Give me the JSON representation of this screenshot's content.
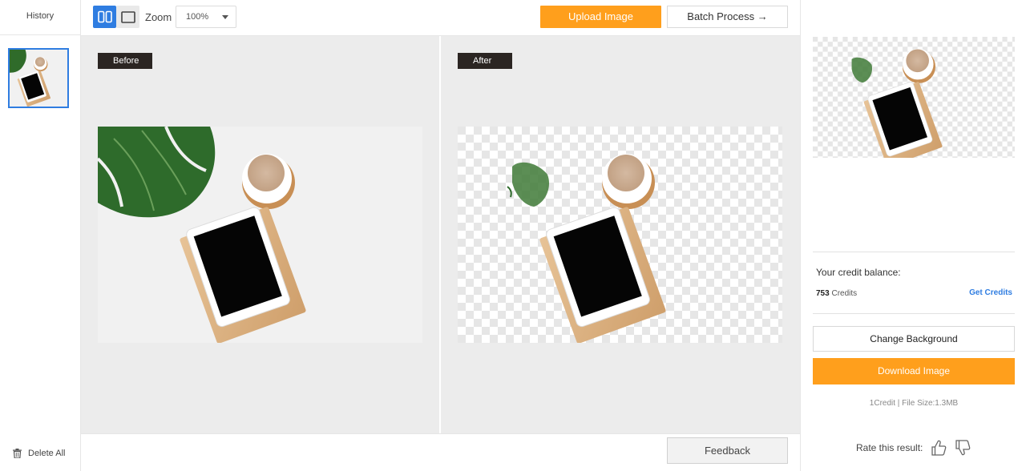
{
  "sidebar": {
    "title": "History",
    "delete_all": "Delete All"
  },
  "toolbar": {
    "zoom_label": "Zoom",
    "zoom_value": "100%",
    "upload_label": "Upload Image",
    "batch_label": "Batch Process →"
  },
  "compare": {
    "before_label": "Before",
    "after_label": "After"
  },
  "bottom": {
    "feedback_label": "Feedback"
  },
  "panel": {
    "credit_title": "Your credit balance:",
    "credit_number": "753",
    "credit_unit": " Credits",
    "get_credits": "Get Credits",
    "change_bg": "Change Background",
    "download": "Download Image",
    "file_info": "1Credit | File Size:1.3MB",
    "rate_label": "Rate this result:"
  },
  "colors": {
    "accent_orange": "#ff9f1c",
    "accent_blue": "#2f7de1",
    "tag_dark": "#2b2522"
  },
  "icons": [
    "split-view-icon",
    "single-view-icon",
    "trash-icon",
    "thumbs-up-icon",
    "thumbs-down-icon",
    "caret-down-icon"
  ]
}
